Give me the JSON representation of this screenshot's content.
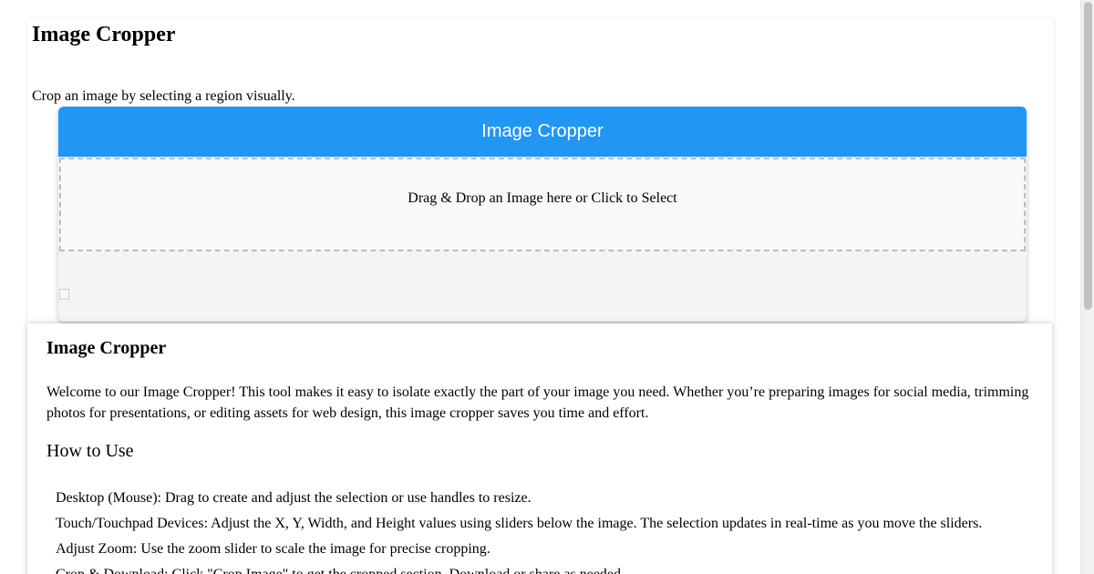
{
  "tool": {
    "title": "Image Cropper",
    "subtitle": "Crop an image by selecting a region visually.",
    "card_header": "Image Cropper",
    "dropzone_text": "Drag & Drop an Image here or Click to Select",
    "preview_icon": "broken-image-icon"
  },
  "article": {
    "title": "Image Cropper",
    "intro": "Welcome to our Image Cropper! This tool makes it easy to isolate exactly the part of your image you need. Whether you’re preparing images for social media, trimming photos for presentations, or editing assets for web design, this image cropper saves you time and effort.",
    "how_to_title": "How to Use",
    "steps": [
      "Desktop (Mouse): Drag to create and adjust the selection or use handles to resize.",
      "Touch/Touchpad Devices: Adjust the X, Y, Width, and Height values using sliders below the image. The selection updates in real-time as you move the sliders.",
      "Adjust Zoom: Use the zoom slider to scale the image for precise cropping.",
      "Crop & Download: Click \"Crop Image\" to get the cropped section. Download or share as needed."
    ]
  },
  "colors": {
    "accent": "#2196f3",
    "dropzone_border": "#bdbdbd",
    "card_bg": "#f4f4f4"
  }
}
